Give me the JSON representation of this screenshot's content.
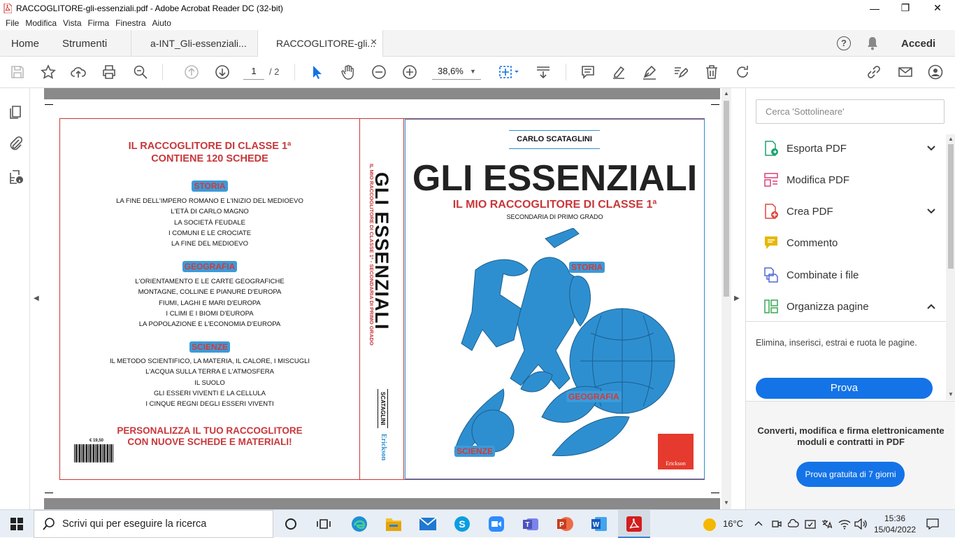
{
  "window": {
    "title": "RACCOGLITORE-gli-essenziali.pdf - Adobe Acrobat Reader DC (32-bit)",
    "minimize_glyph": "—",
    "restore_glyph": "❐",
    "close_glyph": "✕"
  },
  "menu": [
    "File",
    "Modifica",
    "Vista",
    "Firma",
    "Finestra",
    "Aiuto"
  ],
  "tabs": {
    "home": "Home",
    "tools": "Strumenti",
    "doc1": "a-INT_Gli-essenziali...",
    "doc2": "RACCOGLITORE-gli...",
    "close": "×",
    "signin": "Accedi"
  },
  "toolbar": {
    "page_current": "1",
    "page_total": "/ 2",
    "zoom": "38,6%"
  },
  "cover": {
    "back": {
      "headline1": "IL RACCOGLITORE DI CLASSE 1ª",
      "headline2": "CONTIENE 120 SCHEDE",
      "sections": [
        {
          "label": "STORIA",
          "items": [
            "LA FINE DELL'IMPERO ROMANO E L'INIZIO DEL MEDIOEVO",
            "L'ETÀ DI CARLO MAGNO",
            "LA SOCIETÀ FEUDALE",
            "I COMUNI E LE CROCIATE",
            "LA FINE DEL MEDIOEVO"
          ]
        },
        {
          "label": "GEOGRAFIA",
          "items": [
            "L'ORIENTAMENTO E LE CARTE GEOGRAFICHE",
            "MONTAGNE, COLLINE E PIANURE D'EUROPA",
            "FIUMI, LAGHI E MARI D'EUROPA",
            "I CLIMI E I BIOMI D'EUROPA",
            "LA POPOLAZIONE E L'ECONOMIA D'EUROPA"
          ]
        },
        {
          "label": "SCIENZE",
          "items": [
            "IL METODO SCIENTIFICO, LA MATERIA, IL CALORE, I MISCUGLI",
            "L'ACQUA SULLA TERRA E L'ATMOSFERA",
            "IL SUOLO",
            "GLI ESSERI VIVENTI E LA CELLULA",
            "I CINQUE REGNI DEGLI ESSERI VIVENTI"
          ]
        }
      ],
      "footer1": "PERSONALIZZA IL TUO RACCOGLITORE",
      "footer2": "CON NUOVE SCHEDE E MATERIALI!",
      "price": "€ 19,50"
    },
    "spine": {
      "title": "GLI ESSENZIALI",
      "subtitle": "IL MIO RACCOGLITORE DI CLASSE 1ª - SECONDARIA DI PRIMO GRADO",
      "author": "SCATAGLINI",
      "publisher": "Erickson"
    },
    "front": {
      "author": "CARLO SCATAGLINI",
      "title": "GLI ESSENZIALI",
      "subtitle": "IL MIO RACCOGLITORE DI CLASSE 1ª",
      "level": "SECONDARIA DI PRIMO GRADO",
      "label_storia": "STORIA",
      "label_geografia": "GEOGRAFIA",
      "label_scienze": "SCIENZE",
      "publisher": "Erickson"
    }
  },
  "right_panel": {
    "search_placeholder": "Cerca 'Sottolineare'",
    "items": [
      "Esporta PDF",
      "Modifica PDF",
      "Crea PDF",
      "Commento",
      "Combinate i file",
      "Organizza pagine"
    ],
    "organize_desc": "Elimina, inserisci, estrai e ruota le pagine.",
    "try_button": "Prova",
    "promo_text": "Converti, modifica e firma elettronicamente moduli e contratti in PDF",
    "promo_button": "Prova gratuita di 7 giorni"
  },
  "taskbar": {
    "search_placeholder": "Scrivi qui per eseguire la ricerca",
    "temperature": "16°C",
    "time": "15:36",
    "date": "15/04/2022"
  },
  "colors": {
    "accent_blue": "#1473e6",
    "cover_red": "#c8373a",
    "cover_blue": "#2e8fd0"
  }
}
